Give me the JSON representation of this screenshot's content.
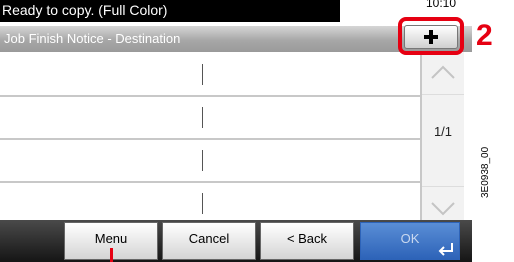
{
  "status": {
    "message": "Ready to copy. (Full Color)",
    "clock": "10:10"
  },
  "title": "Job Finish Notice - Destination",
  "list": {
    "rows": [
      "",
      "",
      "",
      ""
    ]
  },
  "pager": {
    "label": "1/1"
  },
  "add_button": {
    "icon": "plus-icon"
  },
  "callout": {
    "number": "2"
  },
  "footer": {
    "menu": "Menu",
    "cancel": "Cancel",
    "back": "< Back",
    "ok": "OK"
  },
  "figure_code": "3E0938_00",
  "colors": {
    "accent": "#e60012",
    "ok_button": "#2d63b8"
  }
}
